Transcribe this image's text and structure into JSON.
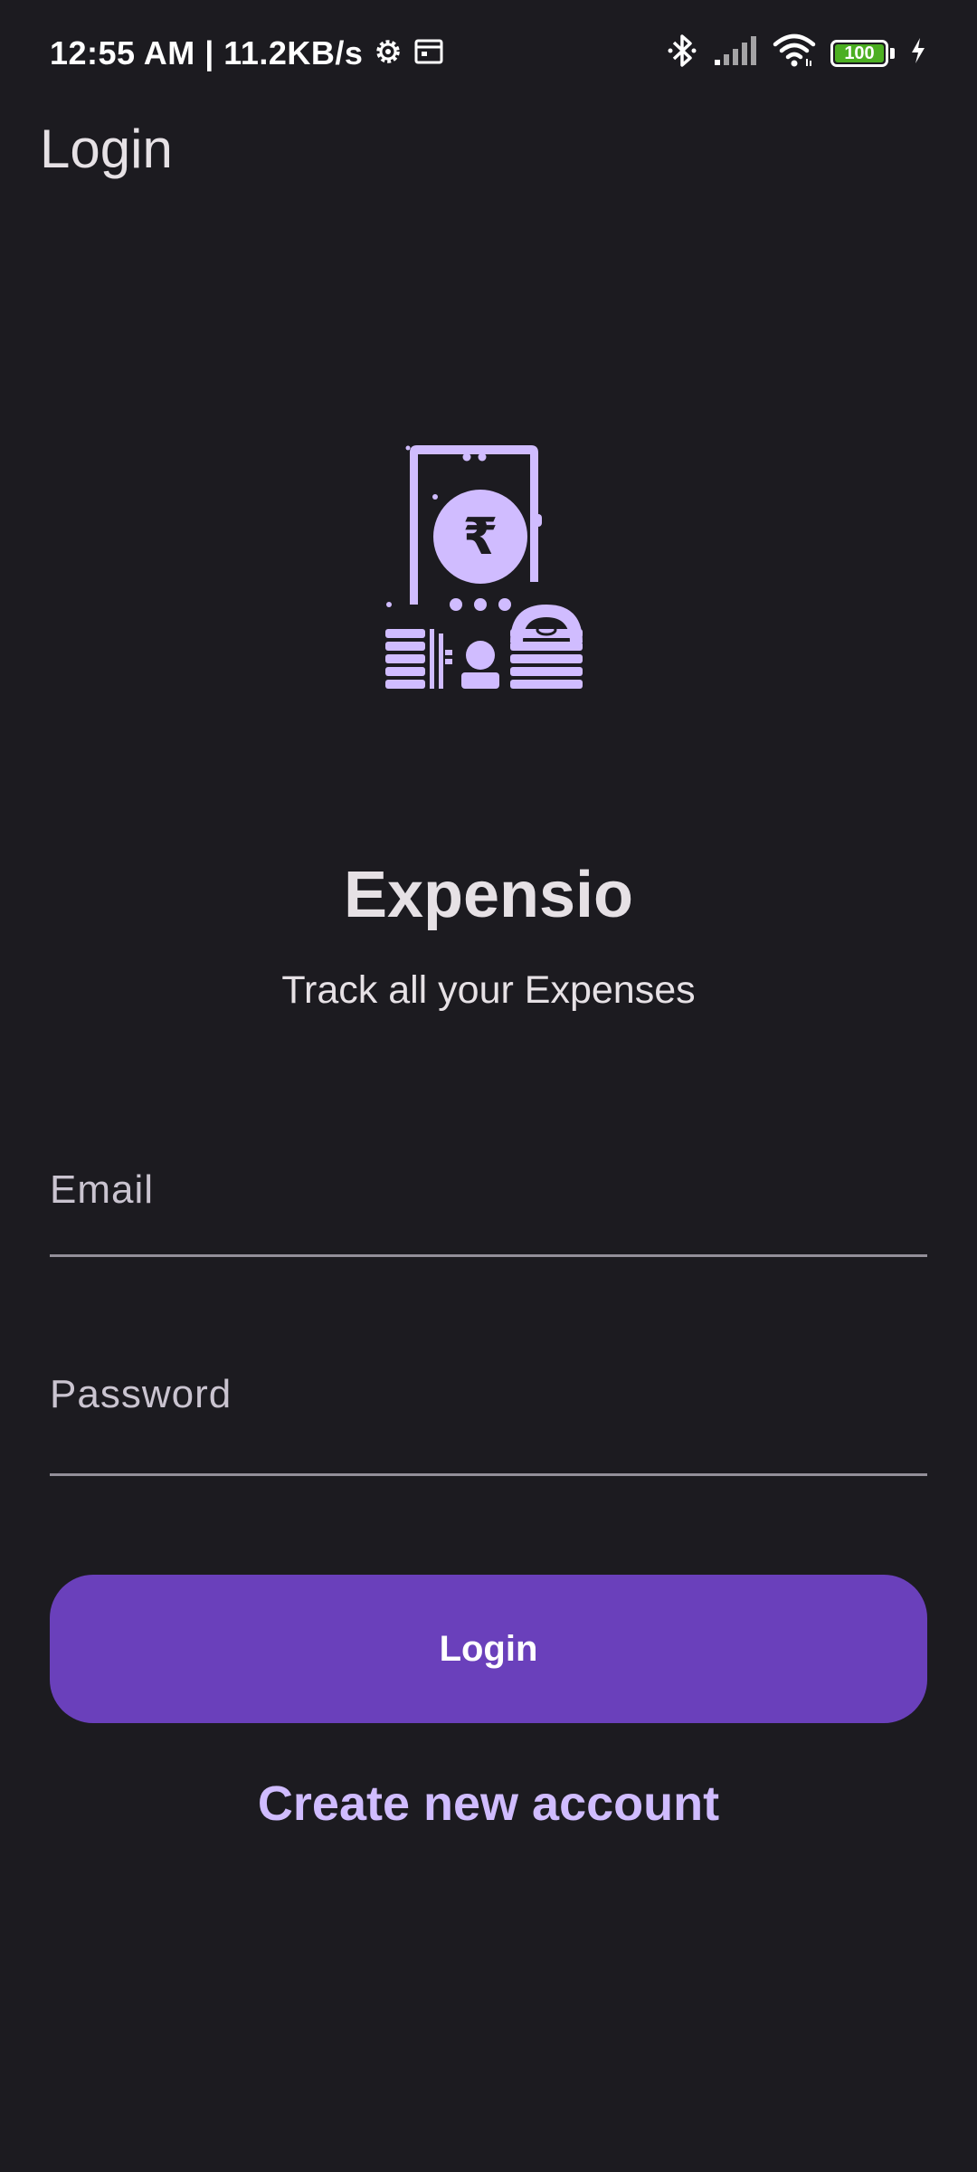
{
  "status_bar": {
    "time_and_speed": "12:55 AM | 11.2KB/s",
    "battery_level": "100",
    "icons": [
      "settings-gear-icon",
      "calendar-icon",
      "bluetooth-icon",
      "cellular-signal-icon",
      "wifi-icon",
      "battery-icon",
      "charging-icon"
    ]
  },
  "app_bar": {
    "title": "Login"
  },
  "hero": {
    "illustration": "phone-rupee-coins-wallet-illustration",
    "rupee_symbol": "₹",
    "brand": "Expensio",
    "tagline": "Track all your Expenses"
  },
  "form": {
    "email_placeholder": "Email",
    "email_value": "",
    "password_placeholder": "Password",
    "password_value": "",
    "login_label": "Login",
    "create_account_label": "Create new account"
  },
  "colors": {
    "background": "#1c1b20",
    "primary_button": "#6a40bb",
    "accent": "#d0bcff",
    "battery_green": "#4caf22"
  }
}
